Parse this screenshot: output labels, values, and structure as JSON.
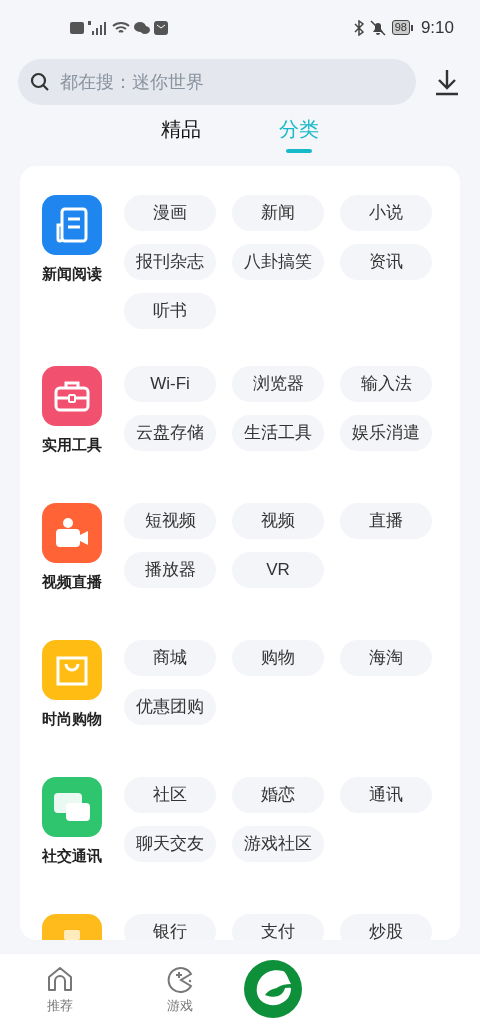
{
  "status_bar": {
    "battery": "98",
    "time": "9:10"
  },
  "search": {
    "placeholder": "都在搜：迷你世界"
  },
  "tabs": [
    {
      "label": "精品",
      "selected": false
    },
    {
      "label": "分类",
      "selected": true
    }
  ],
  "categories": [
    {
      "label": "新闻阅读",
      "color": "#1f86f0",
      "tags": [
        "漫画",
        "新闻",
        "小说",
        "报刊杂志",
        "八卦搞笑",
        "资讯",
        "听书"
      ]
    },
    {
      "label": "实用工具",
      "color": "#f2506f",
      "tags": [
        "Wi-Fi",
        "浏览器",
        "输入法",
        "云盘存储",
        "生活工具",
        "娱乐消遣"
      ]
    },
    {
      "label": "视频直播",
      "color": "#ff6336",
      "tags": [
        "短视频",
        "视频",
        "直播",
        "播放器",
        "VR"
      ]
    },
    {
      "label": "时尚购物",
      "color": "#ffbd14",
      "tags": [
        "商城",
        "购物",
        "海淘",
        "优惠团购"
      ]
    },
    {
      "label": "社交通讯",
      "color": "#2fc46e",
      "tags": [
        "社区",
        "婚恋",
        "通讯",
        "聊天交友",
        "游戏社区"
      ]
    },
    {
      "color": "#ffbb1c",
      "tags": [
        "银行",
        "支付",
        "炒股"
      ]
    }
  ],
  "bottom_nav": [
    {
      "label": "推荐"
    },
    {
      "label": "游戏"
    }
  ]
}
